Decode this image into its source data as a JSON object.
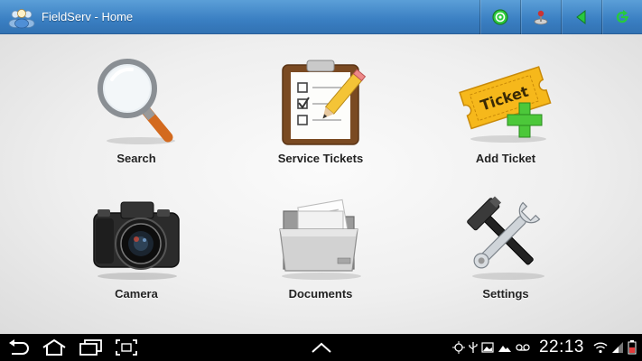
{
  "app": {
    "title": "FieldServ - Home"
  },
  "actionbar": {
    "buttons": [
      {
        "name": "sync-icon",
        "color": "#2ecc40"
      },
      {
        "name": "joystick-icon",
        "color": "#cc3333"
      },
      {
        "name": "back-arrow-icon",
        "color": "#27c93f"
      },
      {
        "name": "refresh-icon",
        "color": "#27c93f"
      }
    ]
  },
  "tiles": [
    {
      "label": "Search",
      "icon": "magnifier-icon"
    },
    {
      "label": "Service Tickets",
      "icon": "clipboard-checklist-icon"
    },
    {
      "label": "Add Ticket",
      "icon": "add-ticket-icon",
      "ticket_text": "Ticket"
    },
    {
      "label": "Camera",
      "icon": "camera-icon"
    },
    {
      "label": "Documents",
      "icon": "folder-documents-icon"
    },
    {
      "label": "Settings",
      "icon": "wrench-hammer-icon"
    }
  ],
  "system_bar": {
    "clock": "22:13",
    "nav": [
      "back-icon",
      "home-icon",
      "recent-apps-icon",
      "screenshot-icon"
    ],
    "center": "up-chevron-icon",
    "status": [
      "gps-icon",
      "usb-icon",
      "image-icon",
      "photo-icon",
      "voicemail-icon",
      "wifi-icon",
      "signal-icon",
      "battery-icon"
    ]
  }
}
